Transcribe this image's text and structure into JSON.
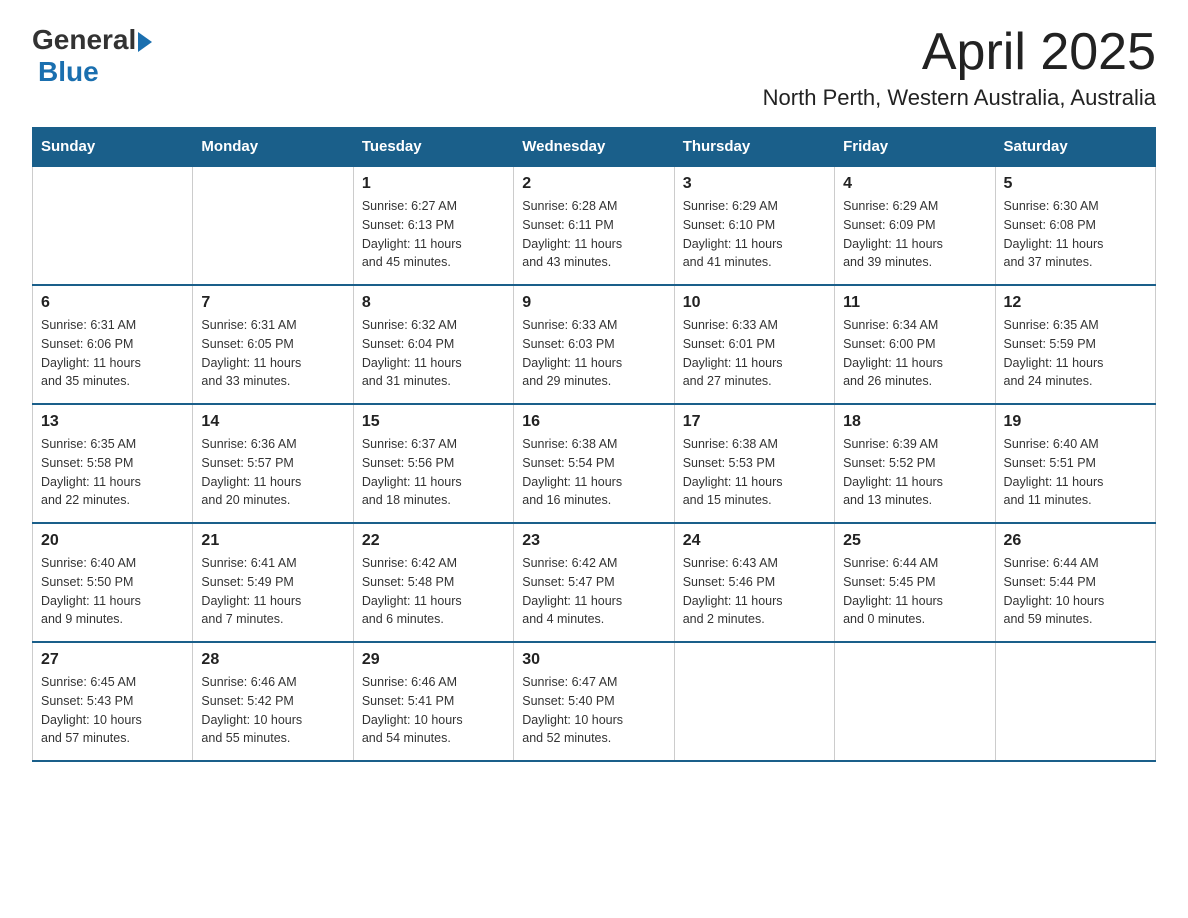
{
  "logo": {
    "text_general": "General",
    "text_blue": "Blue"
  },
  "title": {
    "month_year": "April 2025",
    "location": "North Perth, Western Australia, Australia"
  },
  "columns": [
    "Sunday",
    "Monday",
    "Tuesday",
    "Wednesday",
    "Thursday",
    "Friday",
    "Saturday"
  ],
  "weeks": [
    [
      {
        "day": "",
        "info": ""
      },
      {
        "day": "",
        "info": ""
      },
      {
        "day": "1",
        "info": "Sunrise: 6:27 AM\nSunset: 6:13 PM\nDaylight: 11 hours\nand 45 minutes."
      },
      {
        "day": "2",
        "info": "Sunrise: 6:28 AM\nSunset: 6:11 PM\nDaylight: 11 hours\nand 43 minutes."
      },
      {
        "day": "3",
        "info": "Sunrise: 6:29 AM\nSunset: 6:10 PM\nDaylight: 11 hours\nand 41 minutes."
      },
      {
        "day": "4",
        "info": "Sunrise: 6:29 AM\nSunset: 6:09 PM\nDaylight: 11 hours\nand 39 minutes."
      },
      {
        "day": "5",
        "info": "Sunrise: 6:30 AM\nSunset: 6:08 PM\nDaylight: 11 hours\nand 37 minutes."
      }
    ],
    [
      {
        "day": "6",
        "info": "Sunrise: 6:31 AM\nSunset: 6:06 PM\nDaylight: 11 hours\nand 35 minutes."
      },
      {
        "day": "7",
        "info": "Sunrise: 6:31 AM\nSunset: 6:05 PM\nDaylight: 11 hours\nand 33 minutes."
      },
      {
        "day": "8",
        "info": "Sunrise: 6:32 AM\nSunset: 6:04 PM\nDaylight: 11 hours\nand 31 minutes."
      },
      {
        "day": "9",
        "info": "Sunrise: 6:33 AM\nSunset: 6:03 PM\nDaylight: 11 hours\nand 29 minutes."
      },
      {
        "day": "10",
        "info": "Sunrise: 6:33 AM\nSunset: 6:01 PM\nDaylight: 11 hours\nand 27 minutes."
      },
      {
        "day": "11",
        "info": "Sunrise: 6:34 AM\nSunset: 6:00 PM\nDaylight: 11 hours\nand 26 minutes."
      },
      {
        "day": "12",
        "info": "Sunrise: 6:35 AM\nSunset: 5:59 PM\nDaylight: 11 hours\nand 24 minutes."
      }
    ],
    [
      {
        "day": "13",
        "info": "Sunrise: 6:35 AM\nSunset: 5:58 PM\nDaylight: 11 hours\nand 22 minutes."
      },
      {
        "day": "14",
        "info": "Sunrise: 6:36 AM\nSunset: 5:57 PM\nDaylight: 11 hours\nand 20 minutes."
      },
      {
        "day": "15",
        "info": "Sunrise: 6:37 AM\nSunset: 5:56 PM\nDaylight: 11 hours\nand 18 minutes."
      },
      {
        "day": "16",
        "info": "Sunrise: 6:38 AM\nSunset: 5:54 PM\nDaylight: 11 hours\nand 16 minutes."
      },
      {
        "day": "17",
        "info": "Sunrise: 6:38 AM\nSunset: 5:53 PM\nDaylight: 11 hours\nand 15 minutes."
      },
      {
        "day": "18",
        "info": "Sunrise: 6:39 AM\nSunset: 5:52 PM\nDaylight: 11 hours\nand 13 minutes."
      },
      {
        "day": "19",
        "info": "Sunrise: 6:40 AM\nSunset: 5:51 PM\nDaylight: 11 hours\nand 11 minutes."
      }
    ],
    [
      {
        "day": "20",
        "info": "Sunrise: 6:40 AM\nSunset: 5:50 PM\nDaylight: 11 hours\nand 9 minutes."
      },
      {
        "day": "21",
        "info": "Sunrise: 6:41 AM\nSunset: 5:49 PM\nDaylight: 11 hours\nand 7 minutes."
      },
      {
        "day": "22",
        "info": "Sunrise: 6:42 AM\nSunset: 5:48 PM\nDaylight: 11 hours\nand 6 minutes."
      },
      {
        "day": "23",
        "info": "Sunrise: 6:42 AM\nSunset: 5:47 PM\nDaylight: 11 hours\nand 4 minutes."
      },
      {
        "day": "24",
        "info": "Sunrise: 6:43 AM\nSunset: 5:46 PM\nDaylight: 11 hours\nand 2 minutes."
      },
      {
        "day": "25",
        "info": "Sunrise: 6:44 AM\nSunset: 5:45 PM\nDaylight: 11 hours\nand 0 minutes."
      },
      {
        "day": "26",
        "info": "Sunrise: 6:44 AM\nSunset: 5:44 PM\nDaylight: 10 hours\nand 59 minutes."
      }
    ],
    [
      {
        "day": "27",
        "info": "Sunrise: 6:45 AM\nSunset: 5:43 PM\nDaylight: 10 hours\nand 57 minutes."
      },
      {
        "day": "28",
        "info": "Sunrise: 6:46 AM\nSunset: 5:42 PM\nDaylight: 10 hours\nand 55 minutes."
      },
      {
        "day": "29",
        "info": "Sunrise: 6:46 AM\nSunset: 5:41 PM\nDaylight: 10 hours\nand 54 minutes."
      },
      {
        "day": "30",
        "info": "Sunrise: 6:47 AM\nSunset: 5:40 PM\nDaylight: 10 hours\nand 52 minutes."
      },
      {
        "day": "",
        "info": ""
      },
      {
        "day": "",
        "info": ""
      },
      {
        "day": "",
        "info": ""
      }
    ]
  ]
}
